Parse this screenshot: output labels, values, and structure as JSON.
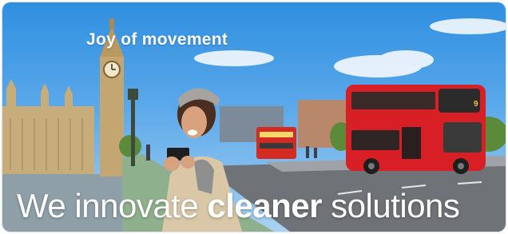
{
  "banner": {
    "tagline": "Joy of movement",
    "headline_pre": "We innovate ",
    "headline_bold": "cleaner",
    "headline_post": " solutions",
    "bus_route": "9"
  },
  "colors": {
    "sky_top": "#2f8fe0",
    "sky_bottom": "#a9d2f1",
    "bus_red": "#d81f26",
    "stone": "#c8ad7c",
    "text": "#ffffff"
  }
}
